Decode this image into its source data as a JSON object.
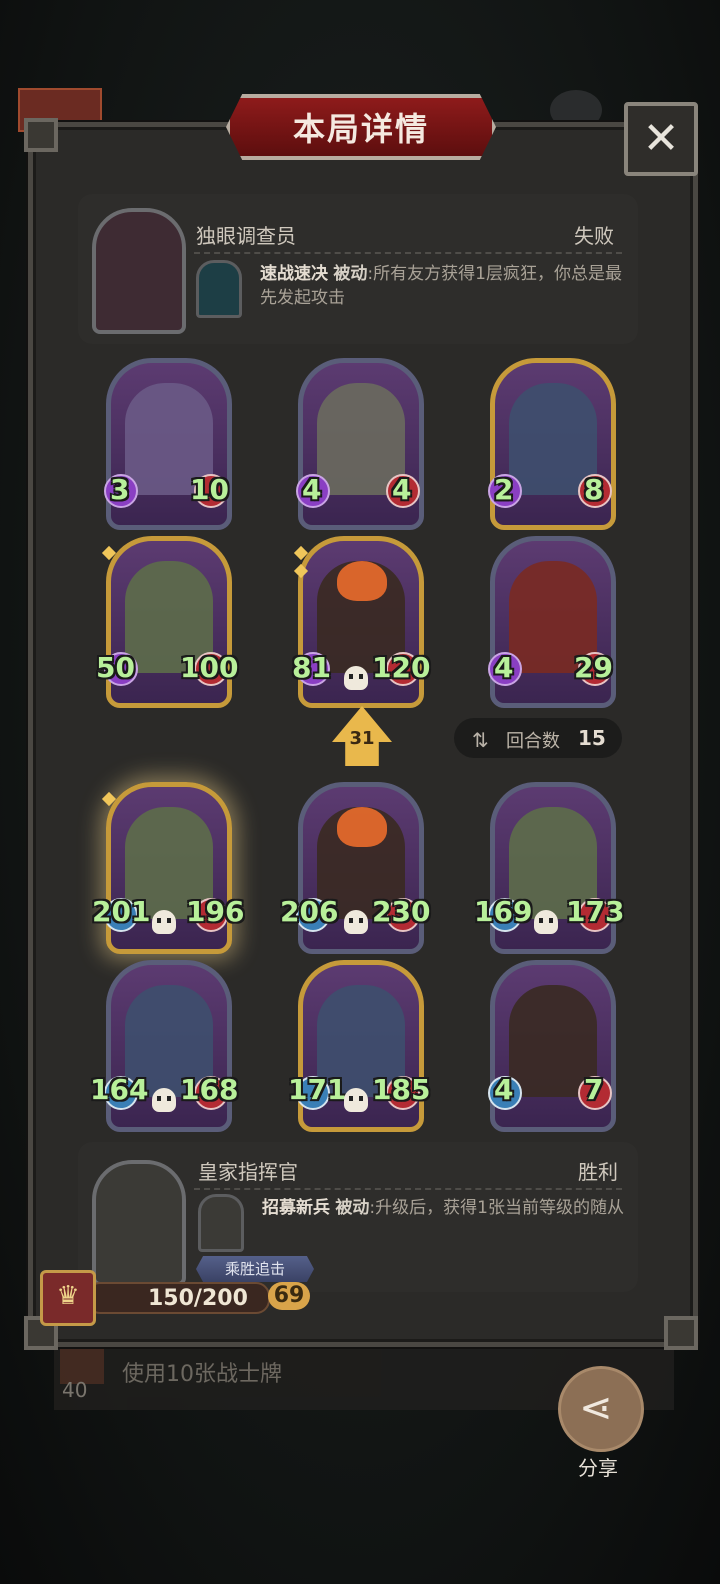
{
  "header": {
    "title": "本局详情"
  },
  "opponent": {
    "name": "独眼调查员",
    "result": "失败",
    "skill": {
      "name": "速战速决",
      "type": "被动",
      "desc": ":所有友方获得1层疯狂，你总是最先发起攻击"
    }
  },
  "opponent_cards": [
    {
      "atk": "3",
      "hp": "10"
    },
    {
      "atk": "4",
      "hp": "4"
    },
    {
      "atk": "2",
      "hp": "8"
    },
    {
      "atk": "50",
      "hp": "100"
    },
    {
      "atk": "81",
      "hp": "120"
    },
    {
      "atk": "4",
      "hp": "29"
    }
  ],
  "center": {
    "damage": "31",
    "rounds_label": "回合数",
    "rounds_value": "15"
  },
  "player_cards": [
    {
      "atk": "201",
      "hp": "196"
    },
    {
      "atk": "206",
      "hp": "230"
    },
    {
      "atk": "169",
      "hp": "173"
    },
    {
      "atk": "164",
      "hp": "168"
    },
    {
      "atk": "171",
      "hp": "185"
    },
    {
      "atk": "4",
      "hp": "7"
    }
  ],
  "player": {
    "name": "皇家指挥官",
    "result": "胜利",
    "skill": {
      "name": "招募新兵",
      "type": "被动",
      "desc": ":升级后，获得1张当前等级的随从"
    },
    "tag": "乘胜追击",
    "xp": "150/200",
    "level": "69"
  },
  "bottom": {
    "count": "40",
    "quest": "使用10张战士牌"
  },
  "share_label": "分享"
}
